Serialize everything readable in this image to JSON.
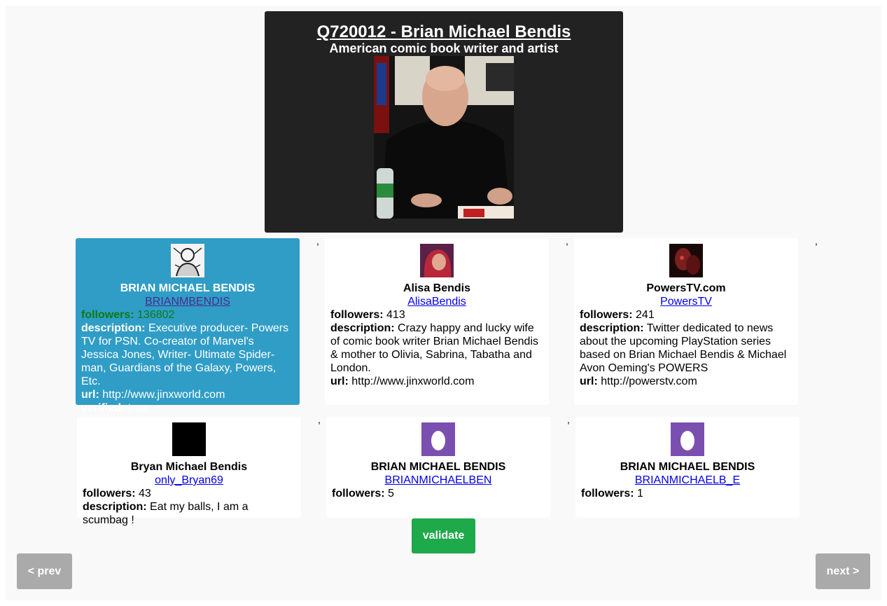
{
  "entity": {
    "title": "Q720012 - Brian Michael Bendis",
    "subtitle": "American comic book writer and artist",
    "photo_icon": "person-photo"
  },
  "labels": {
    "followers": "followers:",
    "description": "description:",
    "url": "url:",
    "verified": "verified:"
  },
  "candidates": [
    {
      "name": "BRIAN MICHAEL BENDIS",
      "handle": "BRIANMBENDIS",
      "followers": "136802",
      "description": "Executive producer- Powers TV for PSN. Co-creator of Marvel's Jessica Jones, Writer- Ultimate Spider-man, Guardians of the Galaxy, Powers, Etc.",
      "url": "http://www.jinxworld.com",
      "verified": "true",
      "avatar_icon": "comic-sketch-avatar"
    },
    {
      "name": "Alisa Bendis",
      "handle": "AlisaBendis",
      "followers": "413",
      "description": "Crazy happy and lucky wife of comic book writer Brian Michael Bendis & mother to Olivia, Sabrina, Tabatha and London.",
      "url": "http://www.jinxworld.com",
      "avatar_icon": "red-hair-avatar"
    },
    {
      "name": "PowersTV.com",
      "handle": "PowersTV",
      "followers": "241",
      "description": "Twitter dedicated to news about the upcoming PlayStation series based on Brian Michael Bendis & Michael Avon Oeming's POWERS",
      "url": "http://powerstv.com",
      "avatar_icon": "dark-red-avatar"
    },
    {
      "name": "Bryan Michael Bendis",
      "handle": "only_Bryan69",
      "followers": "43",
      "description": "Eat my balls, I am a scumbag !",
      "avatar_icon": "black-square-avatar"
    },
    {
      "name": "BRIAN MICHAEL BENDIS",
      "handle": "BRIANMICHAELBEN",
      "followers": "5",
      "avatar_icon": "default-egg-avatar"
    },
    {
      "name": "BRIAN MICHAEL BENDIS",
      "handle": "BRIANMICHAELB_E",
      "followers": "1",
      "avatar_icon": "default-egg-avatar"
    }
  ],
  "separator": ",",
  "buttons": {
    "validate": "validate",
    "prev": "< prev",
    "next": "next >"
  },
  "colors": {
    "selected_card": "#309dc6",
    "validate": "#1ea94a",
    "nav": "#aaaaaa",
    "egg_avatar": "#7b4fb0"
  }
}
